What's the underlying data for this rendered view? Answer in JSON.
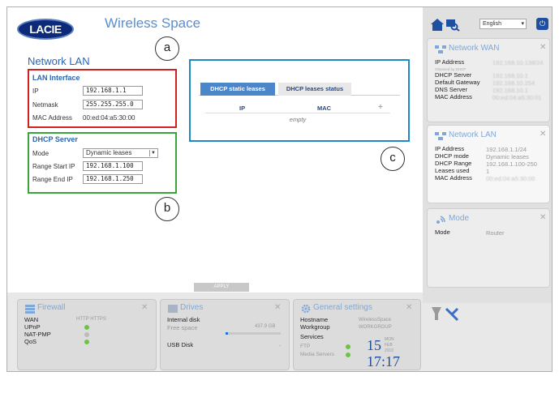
{
  "header": {
    "logo_text": "LACIE",
    "product_name": "Wireless Space"
  },
  "page": {
    "title": "Network LAN"
  },
  "callouts": [
    "a",
    "b",
    "c"
  ],
  "lan_interface": {
    "title": "LAN Interface",
    "ip_label": "IP",
    "ip_value": "192.168.1.1",
    "netmask_label": "Netmask",
    "netmask_value": "255.255.255.0",
    "mac_label": "MAC Address",
    "mac_value": "00:ed:04:a5:30:00"
  },
  "dhcp_server": {
    "title": "DHCP Server",
    "mode_label": "Mode",
    "mode_value": "Dynamic leases",
    "start_label": "Range Start IP",
    "start_value": "192.168.1.100",
    "end_label": "Range End IP",
    "end_value": "192.168.1.250"
  },
  "leases": {
    "tabs": [
      "DHCP static leases",
      "DHCP leases status"
    ],
    "columns": [
      "IP",
      "MAC"
    ],
    "add_symbol": "+",
    "empty_text": "empty"
  },
  "apply_label": "APPLY",
  "topbar": {
    "language": "English"
  },
  "network_wan": {
    "title": "Network WAN",
    "rows": [
      {
        "label": "IP Address",
        "value": "192.168.10.138/24"
      },
      {
        "label": "Obtained by DHCP",
        "value": ""
      },
      {
        "label": "DHCP Server",
        "value": "192.168.10.1"
      },
      {
        "label": "Default Gateway",
        "value": "192.168.10.254"
      },
      {
        "label": "DNS Server",
        "value": "192.168.10.1"
      },
      {
        "label": "MAC Address",
        "value": "00:ed:04:a5:30:01"
      }
    ]
  },
  "network_lan": {
    "title": "Network LAN",
    "rows": [
      {
        "label": "IP Address",
        "value": "192.168.1.1/24"
      },
      {
        "label": "DHCP mode",
        "value": "Dynamic leases"
      },
      {
        "label": "DHCP Range",
        "value": "192.168.1.100-250"
      },
      {
        "label": "Leases used",
        "value": "1"
      },
      {
        "label": "MAC Address",
        "value": "00:ed:04:a5:30:00"
      }
    ]
  },
  "mode_widget": {
    "title": "Mode",
    "label": "Mode",
    "value": "Router"
  },
  "firewall": {
    "title": "Firewall",
    "rows": [
      {
        "label": "WAN",
        "value": "HTTP HTTPS"
      },
      {
        "label": "UPnP",
        "value": ""
      },
      {
        "label": "NAT-PMP",
        "value": ""
      },
      {
        "label": "QoS",
        "value": ""
      }
    ]
  },
  "drives": {
    "title": "Drives",
    "internal_label": "Internal disk",
    "free_label": "Free space",
    "free_value": "437.9 GB",
    "free_fraction": 0.04,
    "usb_label": "USB Disk",
    "usb_value": "-"
  },
  "general": {
    "title": "General settings",
    "hostname_label": "Hostname",
    "hostname_value": "WirelessSpace",
    "workgroup_label": "Workgroup",
    "workgroup_value": "WORKGROUP",
    "services_label": "Services",
    "ftp_label": "FTP",
    "media_label": "Media Servers",
    "day": "15",
    "weekday": "MON",
    "month": "FEB",
    "year": "2010",
    "time": "17:17"
  },
  "colors": {
    "accent": "#2a66b4",
    "red_box": "#d02020",
    "green_box": "#3aa53a",
    "blue_box": "#1e88c8",
    "status_ok": "#6ec24a"
  }
}
